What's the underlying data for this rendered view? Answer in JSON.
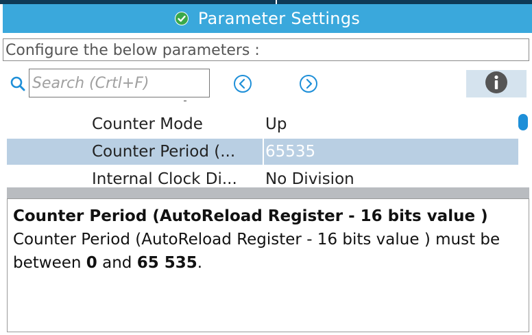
{
  "window": {
    "tab_title": "Parameter Settings"
  },
  "configure_text": "Configure the below parameters :",
  "search": {
    "placeholder": "Search (Crtl+F)",
    "value": ""
  },
  "parameters": [
    {
      "name": "Counter Mode",
      "value": "Up",
      "selected": false
    },
    {
      "name": "Counter Period (...",
      "value": "65535",
      "selected": true
    },
    {
      "name": "Internal Clock Di...",
      "value": "No Division",
      "selected": false
    }
  ],
  "description": {
    "title": "Counter Period (AutoReload Register - 16 bits value )",
    "body_prefix": "Counter Period (AutoReload Register - 16 bits value ) must be between ",
    "min": "0",
    "body_mid": " and ",
    "max": "65 535",
    "body_suffix": "."
  },
  "icons": {
    "tab_status": "check-circle-icon",
    "search": "search-icon",
    "prev": "chevron-left-circle-icon",
    "next": "chevron-right-circle-icon",
    "info": "info-icon"
  },
  "colors": {
    "tab_bar": "#3aa8dc",
    "selected_row": "#b9cfe3",
    "accent": "#1e8fd8",
    "check_icon": "#3aa84a"
  }
}
